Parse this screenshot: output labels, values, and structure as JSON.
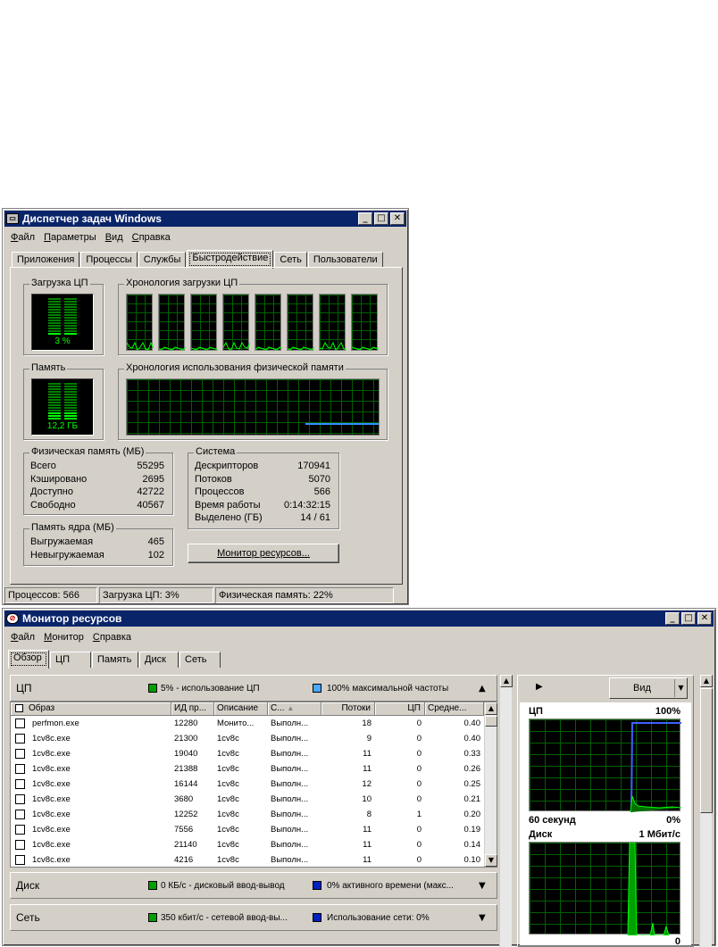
{
  "taskmgr": {
    "title": "Диспетчер задач Windows",
    "menu": [
      "Файл",
      "Параметры",
      "Вид",
      "Справка"
    ],
    "tabs": [
      "Приложения",
      "Процессы",
      "Службы",
      "Быстродействие",
      "Сеть",
      "Пользователи"
    ],
    "cpu_usage_title": "Загрузка ЦП",
    "cpu_usage_value": "3 %",
    "cpu_usage_level": 0.03,
    "cpu_history_title": "Хронология загрузки ЦП",
    "memory_title": "Память",
    "memory_value": "12,2 ГБ",
    "memory_level": 0.22,
    "mem_history_title": "Хронология использования физической памяти",
    "physical": {
      "title": "Физическая память (МБ)",
      "rows": [
        {
          "label": "Всего",
          "value": "55295"
        },
        {
          "label": "Кэшировано",
          "value": "2695"
        },
        {
          "label": "Доступно",
          "value": "42722"
        },
        {
          "label": "Свободно",
          "value": "40567"
        }
      ]
    },
    "kernel": {
      "title": "Память ядра (МБ)",
      "rows": [
        {
          "label": "Выгружаемая",
          "value": "465"
        },
        {
          "label": "Невыгружаемая",
          "value": "102"
        }
      ]
    },
    "system": {
      "title": "Система",
      "rows": [
        {
          "label": "Дескрипторов",
          "value": "170941"
        },
        {
          "label": "Потоков",
          "value": "5070"
        },
        {
          "label": "Процессов",
          "value": "566"
        },
        {
          "label": "Время работы",
          "value": "0:14:32:15"
        },
        {
          "label": "Выделено (ГБ)",
          "value": "14 / 61"
        }
      ]
    },
    "resmon_button": "Монитор ресурсов...",
    "status": [
      "Процессов: 566",
      "Загрузка ЦП: 3%",
      "Физическая память: 22%"
    ]
  },
  "resmon": {
    "title": "Монитор ресурсов",
    "menu": [
      "Файл",
      "Монитор",
      "Справка"
    ],
    "tabs": [
      "Обзор",
      "ЦП",
      "Память",
      "Диск",
      "Сеть"
    ],
    "cpu_section": {
      "title": "ЦП",
      "stat1": "5% - использование ЦП",
      "stat2": "100% максимальной частоты",
      "columns": [
        "Образ",
        "ИД пр...",
        "Описание",
        "С...",
        "Потоки",
        "ЦП",
        "Средне..."
      ],
      "rows": [
        [
          "perfmon.exe",
          "12280",
          "Монито...",
          "Выполн...",
          "18",
          "0",
          "0.40"
        ],
        [
          "1cv8c.exe",
          "21300",
          "1cv8c",
          "Выполн...",
          "9",
          "0",
          "0.40"
        ],
        [
          "1cv8c.exe",
          "19040",
          "1cv8c",
          "Выполн...",
          "11",
          "0",
          "0.33"
        ],
        [
          "1cv8c.exe",
          "21388",
          "1cv8c",
          "Выполн...",
          "11",
          "0",
          "0.26"
        ],
        [
          "1cv8c.exe",
          "16144",
          "1cv8c",
          "Выполн...",
          "12",
          "0",
          "0.25"
        ],
        [
          "1cv8c.exe",
          "3680",
          "1cv8c",
          "Выполн...",
          "10",
          "0",
          "0.21"
        ],
        [
          "1cv8c.exe",
          "12252",
          "1cv8c",
          "Выполн...",
          "8",
          "1",
          "0.20"
        ],
        [
          "1cv8c.exe",
          "7556",
          "1cv8c",
          "Выполн...",
          "11",
          "0",
          "0.19"
        ],
        [
          "1cv8c.exe",
          "21140",
          "1cv8c",
          "Выполн...",
          "11",
          "0",
          "0.14"
        ],
        [
          "1cv8c.exe",
          "4216",
          "1cv8c",
          "Выполн...",
          "11",
          "0",
          "0.10"
        ]
      ]
    },
    "disk_section": {
      "title": "Диск",
      "stat1": "0 КБ/с - дисковый ввод-вывод",
      "stat2": "0% активного времени (макс..."
    },
    "net_section": {
      "title": "Сеть",
      "stat1": "350 кбит/с - сетевой ввод-вы...",
      "stat2": "Использование сети: 0%"
    },
    "view_button": "Вид",
    "graph_cpu": {
      "label": "ЦП",
      "max": "100%",
      "time": "60 секунд",
      "min": "0%"
    },
    "graph_disk": {
      "label": "Диск",
      "max": "1 Мбит/с",
      "min": "0"
    }
  },
  "colors": {
    "titlebar": "#0a246a",
    "graph_green": "#00ff00",
    "cpu_blue": "#4060ff",
    "mem_line": "#3090ff"
  }
}
